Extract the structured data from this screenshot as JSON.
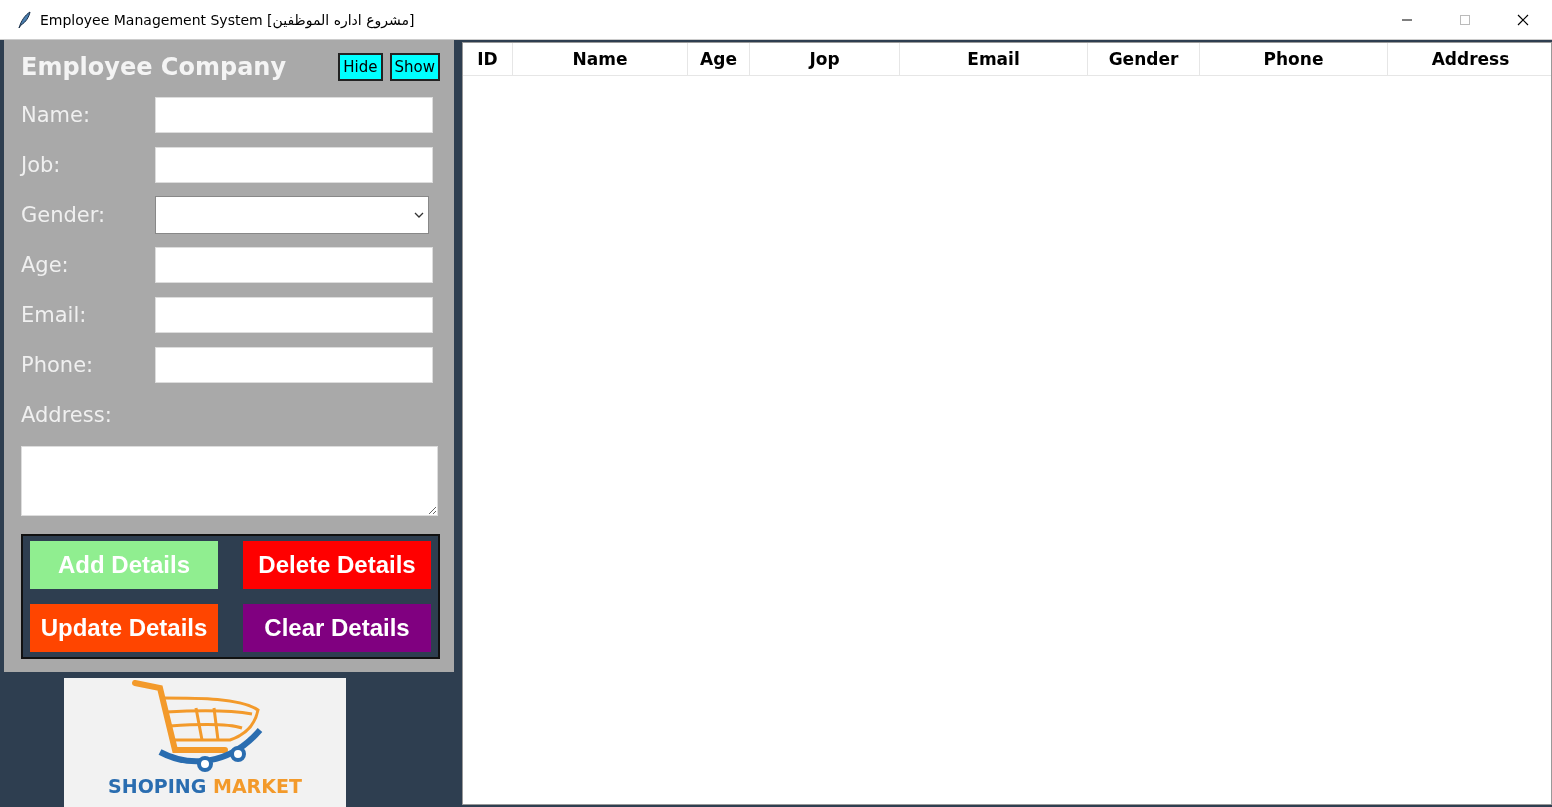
{
  "window": {
    "title": "Employee Management System [مشروع اداره الموظفين]"
  },
  "form": {
    "heading": "Employee Company",
    "toggle_buttons": [
      "Hide",
      "Show"
    ],
    "fields": [
      {
        "label": "Name:",
        "kind": "text"
      },
      {
        "label": "Job:",
        "kind": "text"
      },
      {
        "label": "Gender:",
        "kind": "select"
      },
      {
        "label": "Age:",
        "kind": "text"
      },
      {
        "label": "Email:",
        "kind": "text"
      },
      {
        "label": "Phone:",
        "kind": "text"
      },
      {
        "label": "Address:",
        "kind": "textarea"
      }
    ],
    "buttons": [
      {
        "label": "Add Details",
        "color": "#90ee90"
      },
      {
        "label": "Delete Details",
        "color": "#ff0000"
      },
      {
        "label": "Update Details",
        "color": "#ff4500"
      },
      {
        "label": "Clear Details",
        "color": "#800080"
      }
    ]
  },
  "logo": {
    "words": [
      "SHOPING",
      "MARKET"
    ]
  },
  "table": {
    "columns": [
      "ID",
      "Name",
      "Age",
      "Jop",
      "Email",
      "Gender",
      "Phone",
      "Address"
    ]
  }
}
